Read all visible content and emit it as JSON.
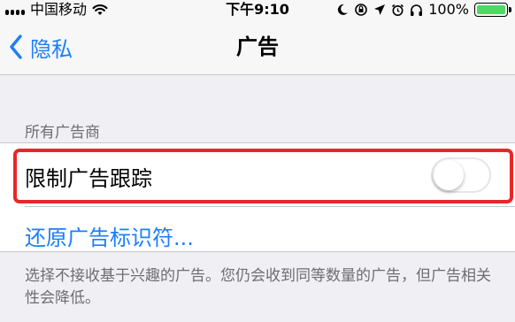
{
  "status_bar": {
    "carrier": "中国移动",
    "time": "下午9:10",
    "battery_text": "100%",
    "battery_level": 1.0,
    "battery_color": "#4cd964"
  },
  "nav": {
    "back_label": "隐私",
    "title": "广告"
  },
  "section": {
    "header": "所有广告商",
    "limit_tracking_label": "限制广告跟踪",
    "limit_tracking_on": false,
    "reset_label": "还原广告标识符...",
    "footer": "选择不接收基于兴趣的广告。您仍会收到同等数量的广告，但广告相关性会降低。"
  },
  "colors": {
    "accent": "#1b7ffb",
    "highlight": "#e8262b"
  }
}
